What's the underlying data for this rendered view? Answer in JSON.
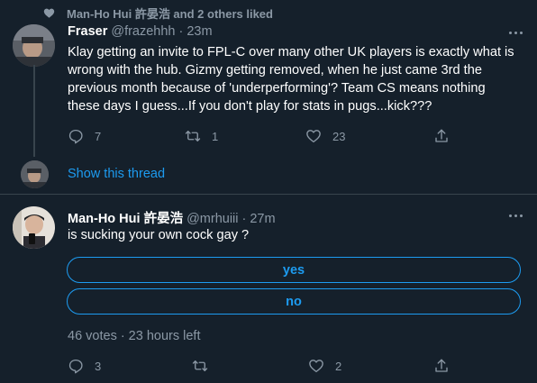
{
  "liked_by": {
    "text": "Man-Ho Hui 許晏浩 and 2 others liked"
  },
  "tweet1": {
    "name": "Fraser",
    "handle": "@frazehhh",
    "separator": "·",
    "time": "23m",
    "text": "Klay getting an invite to FPL-C over many other UK players is exactly what is\nwrong with the hub. Gizmy getting removed, when he just came 3rd the\nprevious month because of 'underperforming'? Team CS means nothing\nthese days I guess...If you don't play for stats in pugs...kick???",
    "replies": "7",
    "retweets": "1",
    "likes": "23"
  },
  "show_thread": {
    "label": "Show this thread"
  },
  "tweet2": {
    "name": "Man-Ho Hui 許晏浩",
    "handle": "@mrhuiii",
    "separator": "·",
    "time": "27m",
    "text": "is sucking your own cock gay ?",
    "poll": {
      "options": [
        "yes",
        "no"
      ],
      "votes": "46 votes",
      "separator": "·",
      "time_left": "23 hours left"
    },
    "replies": "3",
    "retweets": "",
    "likes": "2"
  },
  "icons": {
    "liked": "heart-icon",
    "more": "more-dots-icon",
    "reply": "reply-icon",
    "retweet": "retweet-icon",
    "like": "like-icon",
    "share": "share-icon"
  },
  "colors": {
    "background": "#15202b",
    "accent": "#1d9bf0",
    "secondary_text": "#8b98a5",
    "divider": "#38444d",
    "primary_text": "#ffffff"
  }
}
